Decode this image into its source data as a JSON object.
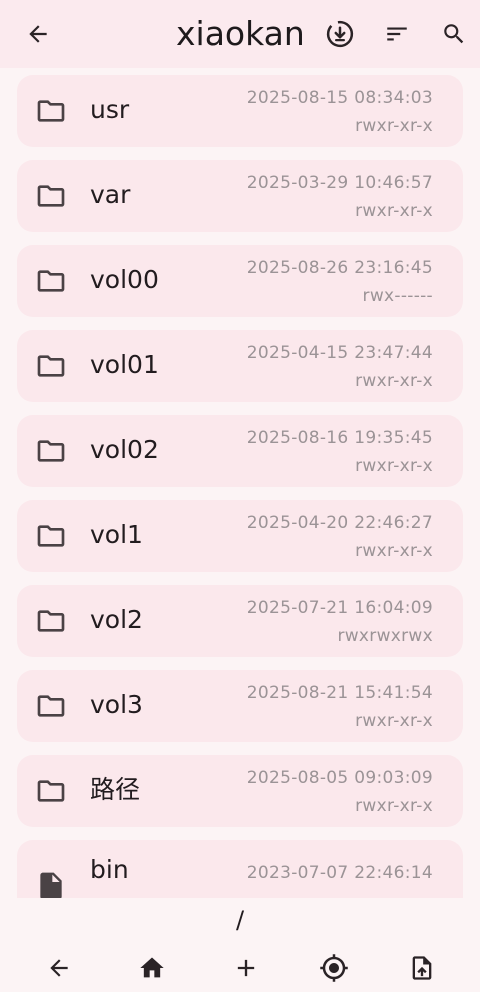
{
  "header": {
    "title": "xiaokan",
    "back_icon": "arrow-back-icon",
    "download_icon": "download-circle-icon",
    "sort_icon": "sort-icon",
    "search_icon": "search-icon"
  },
  "files": [
    {
      "name": "usr",
      "type": "folder",
      "date": "2025-08-15 08:34:03",
      "perm": "rwxr-xr-x"
    },
    {
      "name": "var",
      "type": "folder",
      "date": "2025-03-29 10:46:57",
      "perm": "rwxr-xr-x"
    },
    {
      "name": "vol00",
      "type": "folder",
      "date": "2025-08-26 23:16:45",
      "perm": "rwx------"
    },
    {
      "name": "vol01",
      "type": "folder",
      "date": "2025-04-15 23:47:44",
      "perm": "rwxr-xr-x"
    },
    {
      "name": "vol02",
      "type": "folder",
      "date": "2025-08-16 19:35:45",
      "perm": "rwxr-xr-x"
    },
    {
      "name": "vol1",
      "type": "folder",
      "date": "2025-04-20 22:46:27",
      "perm": "rwxr-xr-x"
    },
    {
      "name": "vol2",
      "type": "folder",
      "date": "2025-07-21 16:04:09",
      "perm": "rwxrwxrwx"
    },
    {
      "name": "vol3",
      "type": "folder",
      "date": "2025-08-21 15:41:54",
      "perm": "rwxr-xr-x"
    },
    {
      "name": "路径",
      "type": "folder",
      "date": "2025-08-05 09:03:09",
      "perm": "rwxr-xr-x"
    },
    {
      "name": "bin",
      "type": "file",
      "date": "2023-07-07 22:46:14",
      "perm": ""
    }
  ],
  "path": "/",
  "bottom_nav": {
    "back_icon": "arrow-back-icon",
    "home_icon": "home-icon",
    "add_icon": "add-icon",
    "locate_icon": "gps-locate-icon",
    "upload_icon": "file-upload-icon"
  },
  "colors": {
    "background": "#fcf4f5",
    "header": "#fbeaee",
    "card": "#fbe8ec",
    "text": "#221c1f",
    "secondary_text": "#9b9396",
    "icon": "#4a4245"
  }
}
